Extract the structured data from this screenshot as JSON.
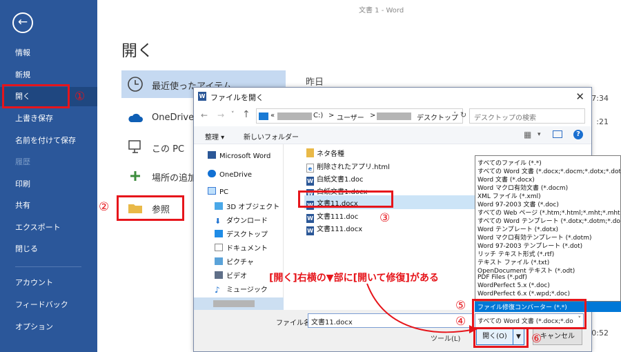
{
  "window_title": "文書 1 - Word",
  "sidebar": {
    "items": [
      {
        "label": "情報"
      },
      {
        "label": "新規"
      },
      {
        "label": "開く"
      },
      {
        "label": "上書き保存"
      },
      {
        "label": "名前を付けて保存"
      },
      {
        "label": "履歴"
      },
      {
        "label": "印刷"
      },
      {
        "label": "共有"
      },
      {
        "label": "エクスポート"
      },
      {
        "label": "閉じる"
      },
      {
        "label": "アカウント"
      },
      {
        "label": "フィードバック"
      },
      {
        "label": "オプション"
      }
    ]
  },
  "backstage": {
    "title": "開く",
    "places": [
      {
        "label": "最近使ったアイテム"
      },
      {
        "label": "OneDrive"
      },
      {
        "label": "この PC"
      },
      {
        "label": "場所の追加"
      },
      {
        "label": "参照"
      }
    ],
    "recent_heading": "昨日",
    "recent_times": [
      "7:34",
      ":21",
      "0:52"
    ]
  },
  "dialog": {
    "title": "ファイルを開く",
    "address": {
      "prefix": "«",
      "drive": "C:)",
      "sep1": ">",
      "folder1": "ユーザー",
      "sep2": ">",
      "folder2": "デスクトップ"
    },
    "search_placeholder": "デスクトップの検索",
    "toolbar": {
      "organize": "整理 ▾",
      "new_folder": "新しいフォルダー"
    },
    "nav": [
      {
        "label": "Microsoft Word"
      },
      {
        "label": "OneDrive"
      },
      {
        "label": "PC"
      },
      {
        "label": "3D オブジェクト"
      },
      {
        "label": "ダウンロード"
      },
      {
        "label": "デスクトップ"
      },
      {
        "label": "ドキュメント"
      },
      {
        "label": "ピクチャ"
      },
      {
        "label": "ビデオ"
      },
      {
        "label": "ミュージック"
      }
    ],
    "files": [
      {
        "name": "ネタ各種"
      },
      {
        "name": "削除されたアプリ.html"
      },
      {
        "name": "白紙文書1.doc"
      },
      {
        "name": "白紙文書1.docx"
      },
      {
        "name": "文書11.docx"
      },
      {
        "name": "文書111.doc"
      },
      {
        "name": "文書111.docx"
      }
    ],
    "filename_label": "ファイル名(N):",
    "filename_value": "文書11.docx",
    "filetype_value": "すべての Word 文書 (*.docx;*.do",
    "tools_label": "ツール(L)",
    "open_label": "開く(O)",
    "cancel_label": "キャンセル"
  },
  "type_options": [
    "すべてのファイル (*.*)",
    "すべての Word 文書 (*.docx;*.docm;*.dotx;*.dotm",
    "Word 文書 (*.docx)",
    "Word マクロ有効文書 (*.docm)",
    "XML ファイル (*.xml)",
    "Word 97-2003 文書 (*.doc)",
    "すべての Web ページ (*.htm;*.html;*.mht;*.mhtml)",
    "すべての Word テンプレート (*.dotx;*.dotm;*.dot)",
    "Word テンプレート (*.dotx)",
    "Word マクロ有効テンプレート (*.dotm)",
    "Word 97-2003 テンプレート (*.dot)",
    "リッチ テキスト形式 (*.rtf)",
    "テキスト ファイル (*.txt)",
    "OpenDocument テキスト (*.odt)",
    "PDF Files (*.pdf)",
    "WordPerfect 5.x (*.doc)",
    "WordPerfect 6.x (*.wpd;*.doc)"
  ],
  "type_highlight": "ファイル修復コンバーター (*.*)",
  "annotation": "[開く]右横の▼部に[開いて修復]がある",
  "markers": [
    "①",
    "②",
    "③",
    "④",
    "⑤",
    "⑥"
  ],
  "colors": {
    "sidebar": "#2b579a",
    "accent_red": "#e6151b",
    "highlight_blue": "#0078d7"
  }
}
